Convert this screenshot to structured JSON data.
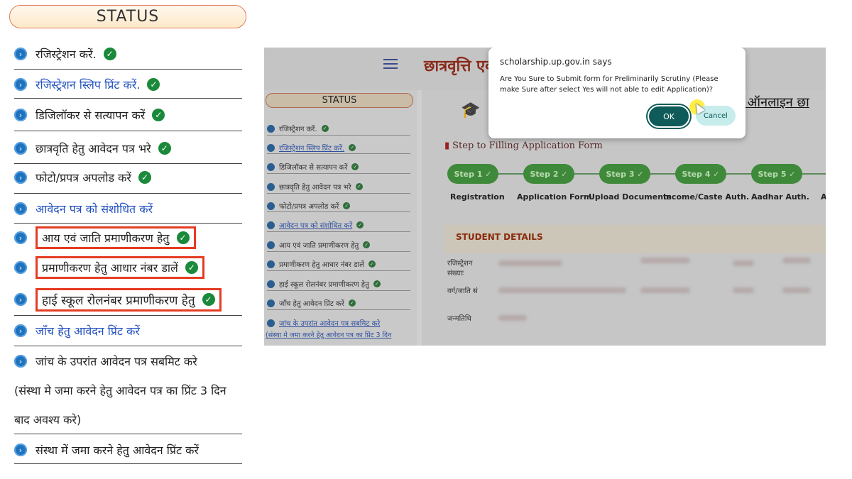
{
  "left_panel": {
    "title": "STATUS",
    "items": [
      {
        "label": "रजिस्ट्रेशन करें.",
        "checked": true
      },
      {
        "label": "रजिस्ट्रेशन स्लिप प्रिंट करें.",
        "checked": true
      },
      {
        "label": "डिजिलॉकर से सत्यापन करें",
        "checked": true
      },
      {
        "label": "छात्रवृति हेतु आवेदन पत्र भरे",
        "checked": true
      },
      {
        "label": "फोटो/प्रपत्र अपलोड करें",
        "checked": true
      },
      {
        "label": "आवेदन पत्र को संशोधित करें",
        "checked": false
      },
      {
        "label": "आय एवं जाति प्रमाणीकरण हेतु",
        "checked": true
      },
      {
        "label": "प्रमाणीकरण हेतु आधार नंबर डालें",
        "checked": true
      },
      {
        "label": "हाई स्कूल रोलनंबर प्रमाणीकरण हेतु",
        "checked": true
      },
      {
        "label": "जाँच हेतु आवेदन प्रिंट करें",
        "checked": false
      },
      {
        "label": "जांच के उपरांत आवेदन पत्र सबमिट करे",
        "checked": false
      },
      {
        "label": "संस्था में जमा करने हेतु आवेदन प्रिंट करें",
        "checked": false
      }
    ],
    "note_line1": "(संस्था मे जमा करने हेतु आवेदन पत्र का प्रिंट 3 दिन",
    "note_line2": "बाद अवश्य करे)"
  },
  "screenshot": {
    "portal_title": "छात्रवृत्ति एवं",
    "online_title": "ए ऑनलाइन छा",
    "sidebar_title": "STATUS",
    "sidebar_items": [
      "रजिस्ट्रेशन करें.",
      "रजिस्ट्रेशन स्लिप प्रिंट करें.",
      "डिजिलॉकर से सत्यापन करें",
      "छात्रवृति हेतु आवेदन पत्र भरे",
      "फोटो/प्रपत्र अपलोड करें",
      "आवेदन पत्र को संशोधित करें",
      "आय एवं जाति प्रमाणीकरण हेतु",
      "प्रमाणीकरण हेतु आधार नंबर डालें",
      "हाई स्कूल रोलनंबर प्रमाणीकरण हेतु",
      "जाँच हेतु आवेदन प्रिंट करें",
      "जांच के उपरांत आवेदन पत्र सबमिट करे"
    ],
    "sidebar_note": "(संस्था मे जमा करने हेतु आवेदन पत्र का प्रिंट 3 दिन",
    "step_heading": "Step to Filling Application Form",
    "steps": [
      {
        "pill": "Step 1",
        "label": "Registration"
      },
      {
        "pill": "Step 2",
        "label": "Application Form"
      },
      {
        "pill": "Step 3",
        "label": "Upload Documents"
      },
      {
        "pill": "Step 4",
        "label": "Income/Caste Auth."
      },
      {
        "pill": "Step 5",
        "label": "Aadhar Auth."
      }
    ],
    "step_trailing": "A",
    "student_details_title": "STUDENT DETAILS",
    "field_labels": [
      "रजिस्ट्रेशन",
      "संख्याः",
      "वर्ग/जाति सं",
      "जन्मतिथि"
    ]
  },
  "dialog": {
    "title": "scholarship.up.gov.in says",
    "message": "Are You Sure to Submit form for Preliminarily Scrutiny (Please make Sure after select Yes will not able to edit Application)?",
    "ok_label": "OK",
    "cancel_label": "Cancel"
  },
  "colors": {
    "accent_blue": "#1f4fbf",
    "check_green": "#1a8a3a",
    "highlight_red": "#e53c23",
    "ok_button": "#0f5b59"
  }
}
